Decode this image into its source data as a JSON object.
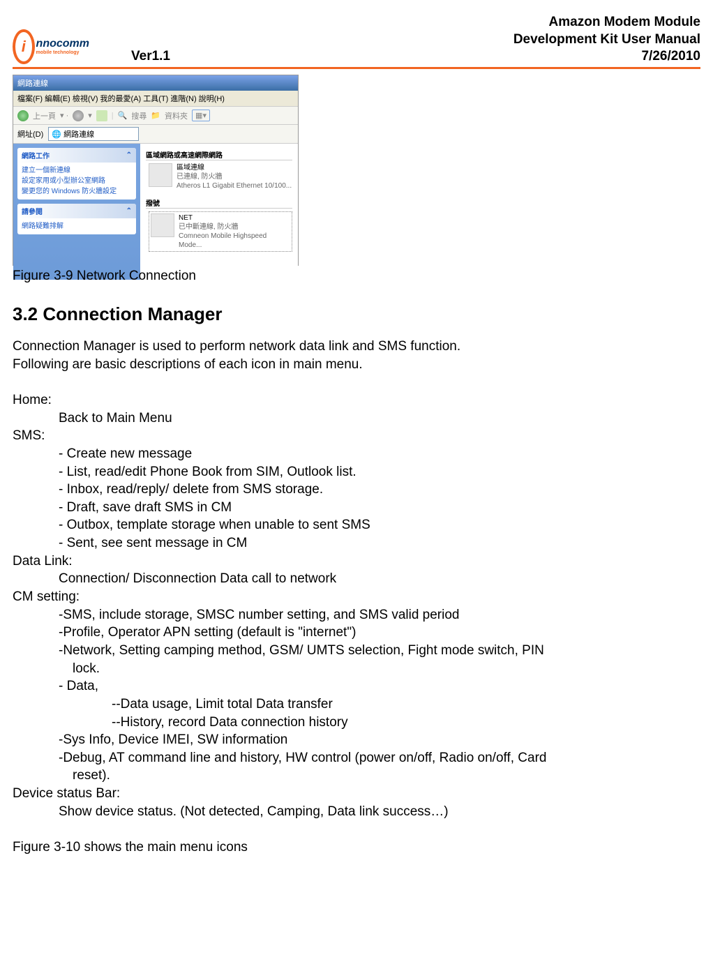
{
  "header": {
    "version": "Ver1.1",
    "title_line1": "Amazon Modem Module",
    "title_line2": "Development Kit User Manual",
    "date": "7/26/2010",
    "logo_name": "nnocomm",
    "logo_sub": "mobile technology"
  },
  "screenshot": {
    "title": "網路連線",
    "menu": "檔案(F)  編輯(E)  檢視(V)  我的最愛(A)  工具(T)  進階(N)  說明(H)",
    "toolbar_back": "上一頁",
    "toolbar_search": "搜尋",
    "toolbar_folders": "資料夾",
    "address_label": "網址(D)",
    "address_value": "網路連線",
    "panel1_title": "網路工作",
    "panel1_item1": "建立一個新連線",
    "panel1_item2": "設定家用或小型辦公室網路",
    "panel1_item3": "變更您的 Windows 防火牆設定",
    "panel2_title": "請參閱",
    "panel2_item1": "網路疑難排解",
    "section1_title": "區域網路或高速網際網路",
    "conn1_name": "區域連線",
    "conn1_status": "已連線, 防火牆",
    "conn1_device": "Atheros L1 Gigabit Ethernet 10/100...",
    "section2_title": "撥號",
    "conn2_name": "NET",
    "conn2_status": "已中斷連線, 防火牆",
    "conn2_device": "Comneon Mobile Highspeed Mode..."
  },
  "figure_caption": "Figure 3-9 Network Connection",
  "section_heading": "3.2  Connection Manager",
  "intro_line1": "Connection Manager is used to perform network data link and SMS function.",
  "intro_line2": "Following are basic descriptions of each icon in main menu.",
  "home_label": "Home:",
  "home_desc": "Back to Main Menu",
  "sms_label": "SMS:",
  "sms_items": [
    "- Create new message",
    "- List, read/edit Phone Book from SIM, Outlook list.",
    "- Inbox, read/reply/ delete from SMS storage.",
    "- Draft, save draft SMS in CM",
    "- Outbox, template storage when unable to sent SMS",
    "- Sent, see sent message in CM"
  ],
  "datalink_label": "Data Link:",
  "datalink_desc": "Connection/ Disconnection Data call to network",
  "cmsetting_label": "CM setting:",
  "cmsetting_items": {
    "i1": "-SMS, include storage, SMSC number setting, and SMS valid period",
    "i2": "-Profile, Operator APN setting (default is \"internet\")",
    "i3a": "-Network, Setting camping method, GSM/ UMTS selection, Fight mode switch, PIN",
    "i3b": "lock.",
    "i4": "- Data,",
    "i4a": "--Data usage, Limit total Data transfer",
    "i4b": "--History, record Data connection history",
    "i5": "-Sys Info, Device IMEI, SW information",
    "i6a": "-Debug, AT command line and history, HW control (power on/off, Radio on/off, Card",
    "i6b": "reset)."
  },
  "devicestatus_label": "Device status Bar:",
  "devicestatus_desc": "Show device status. (Not detected, Camping, Data link success…)",
  "closing": "Figure 3-10 shows the main menu icons"
}
